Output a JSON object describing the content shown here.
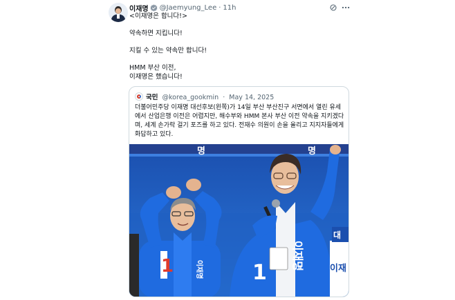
{
  "post": {
    "author_name": "이재명",
    "handle": "@Jaemyung_Lee",
    "separator": "·",
    "time": "11h",
    "lines": [
      "<이재명은 합니다!>",
      "약속하면 지킵니다!",
      "지킬 수 있는 약속만 합니다!",
      "HMM 부산 이전,",
      "이재명은 했습니다!"
    ]
  },
  "quote": {
    "author_name": "국민",
    "handle": "@korea_gookmin",
    "separator": "·",
    "date": "May 14, 2025",
    "text": "더불어민주당 이재명 대선후보(왼쪽)가 14일 부산 부산진구 서면에서 열린 유세에서 산업은행 이전은 어렵지만, 해수부와 HMM 본사 부산 이전 약속을 지키겠다며, 세계 손가락 걸기 포즈를 하고 있다. 전재수 의원이 손을 올리고 지지자들에게 화답하고 있다.",
    "photo": {
      "banner_left": "명",
      "banner_right": "명",
      "vest_left_number": "1",
      "vest_left_name": "이재명",
      "vest_right_number": "1",
      "vest_right_name": "이재명",
      "sign_text": "이재",
      "sign_text_top": "대"
    }
  },
  "colors": {
    "accent": "#1d9bf0",
    "text": "#0f1419",
    "muted": "#536471",
    "border": "#cfd9de",
    "campaign_blue": "#1d64c8"
  },
  "icons": {
    "verified": "verified-badge-icon",
    "grok": "grok-icon",
    "more": "more-options-icon"
  }
}
